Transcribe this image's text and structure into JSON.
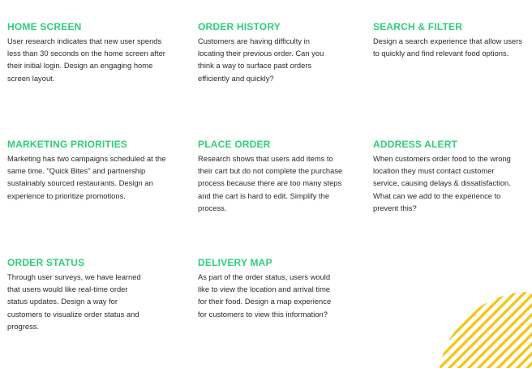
{
  "cards": [
    {
      "title": "HOME SCREEN",
      "body": "User research indicates that new user spends less than 30 seconds on the home screen after their initial login. Design an engaging home screen layout."
    },
    {
      "title": "ORDER HISTORY",
      "body": "Customers are having difficulty in locating their previous order. Can you think a way to surface past orders efficiently and quickly?"
    },
    {
      "title": "SEARCH & FILTER",
      "body": "Design a search experience that allow users to quickly and find relevant food options."
    },
    {
      "title": "MARKETING PRIORITIES",
      "body": "Marketing has two campaigns scheduled at the same time. \"Quick Bites\" and partnership sustainably sourced restaurants. Design an experience to prioritize promotions."
    },
    {
      "title": "PLACE ORDER",
      "body": "Research shows that users add items to their cart but do not complete the purchase process because there are too many steps and the cart is hard to edit. Simplify the process."
    },
    {
      "title": "ADDRESS ALERT",
      "body": "When customers order food to the wrong location they must contact customer service, causing delays & dissatisfaction. What can we add to the experience to prevent this?"
    },
    {
      "title": "ORDER STATUS",
      "body": "Through user surveys, we have learned that users would like real-time order status updates. Design a way for customers to visualize order status and progress."
    },
    {
      "title": "DELIVERY MAP",
      "body": "As part of the order status, users would like to view the location and arrival time for their food. Design a map experience for customers to view this information?"
    }
  ],
  "colors": {
    "heading": "#2fce7d",
    "body_text": "#2a2a2a",
    "decor_stripes": "#f5c518"
  }
}
